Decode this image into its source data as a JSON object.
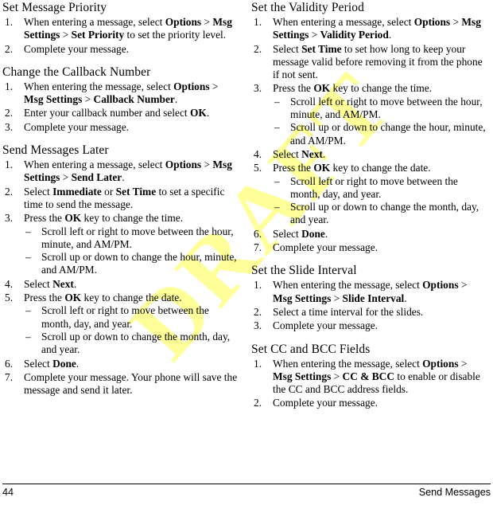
{
  "page": {
    "number": "44",
    "running_head": "Send Messages",
    "watermark": "DRAFT",
    "watermark_color": "#ffff99"
  },
  "left_column": {
    "sections": [
      {
        "heading": "Set Message Priority",
        "steps": [
          {
            "parts": [
              {
                "t": "When entering a message, select ",
                "b": false
              },
              {
                "t": "Options",
                "b": true
              },
              {
                "t": " > ",
                "b": false
              },
              {
                "t": "Msg Settings",
                "b": true
              },
              {
                "t": " > ",
                "b": false
              },
              {
                "t": "Set Priority",
                "b": true
              },
              {
                "t": " to set the priority level.",
                "b": false
              }
            ],
            "subs": []
          },
          {
            "parts": [
              {
                "t": "Complete your message.",
                "b": false
              }
            ],
            "subs": []
          }
        ]
      },
      {
        "heading": "Change the Callback Number",
        "steps": [
          {
            "parts": [
              {
                "t": "When entering the message, select ",
                "b": false
              },
              {
                "t": "Options",
                "b": true
              },
              {
                "t": " > ",
                "b": false
              },
              {
                "t": "Msg Settings",
                "b": true
              },
              {
                "t": " > ",
                "b": false
              },
              {
                "t": "Callback Number",
                "b": true
              },
              {
                "t": ".",
                "b": false
              }
            ],
            "subs": []
          },
          {
            "parts": [
              {
                "t": "Enter your callback number and select ",
                "b": false
              },
              {
                "t": "OK",
                "b": true
              },
              {
                "t": ".",
                "b": false
              }
            ],
            "subs": []
          },
          {
            "parts": [
              {
                "t": "Complete your message.",
                "b": false
              }
            ],
            "subs": []
          }
        ]
      },
      {
        "heading": "Send Messages Later",
        "steps": [
          {
            "parts": [
              {
                "t": "When entering a message, select ",
                "b": false
              },
              {
                "t": "Options",
                "b": true
              },
              {
                "t": " > ",
                "b": false
              },
              {
                "t": "Msg Settings",
                "b": true
              },
              {
                "t": " > ",
                "b": false
              },
              {
                "t": "Send Later",
                "b": true
              },
              {
                "t": ".",
                "b": false
              }
            ],
            "subs": []
          },
          {
            "parts": [
              {
                "t": "Select ",
                "b": false
              },
              {
                "t": "Immediate",
                "b": true
              },
              {
                "t": " or ",
                "b": false
              },
              {
                "t": "Set Time",
                "b": true
              },
              {
                "t": " to set a specific time to send the message.",
                "b": false
              }
            ],
            "subs": []
          },
          {
            "parts": [
              {
                "t": "Press the ",
                "b": false
              },
              {
                "t": "OK",
                "b": true
              },
              {
                "t": " key to change the time.",
                "b": false
              }
            ],
            "subs": [
              "Scroll left or right to move between the hour, minute, and AM/PM.",
              "Scroll up or down to change the hour, minute, and AM/PM."
            ]
          },
          {
            "parts": [
              {
                "t": "Select ",
                "b": false
              },
              {
                "t": "Next",
                "b": true
              },
              {
                "t": ".",
                "b": false
              }
            ],
            "subs": []
          },
          {
            "parts": [
              {
                "t": "Press the ",
                "b": false
              },
              {
                "t": "OK",
                "b": true
              },
              {
                "t": " key to change the date.",
                "b": false
              }
            ],
            "subs": [
              "Scroll left or right to move between the month, day, and year.",
              "Scroll up or down to change the month, day, and year."
            ]
          },
          {
            "parts": [
              {
                "t": "Select ",
                "b": false
              },
              {
                "t": "Done",
                "b": true
              },
              {
                "t": ".",
                "b": false
              }
            ],
            "subs": []
          },
          {
            "parts": [
              {
                "t": "Complete your message. Your phone will save the message and send it later.",
                "b": false
              }
            ],
            "subs": []
          }
        ]
      }
    ]
  },
  "right_column": {
    "sections": [
      {
        "heading": "Set the Validity Period",
        "steps": [
          {
            "parts": [
              {
                "t": "When entering a message, select ",
                "b": false
              },
              {
                "t": "Options",
                "b": true
              },
              {
                "t": " > ",
                "b": false
              },
              {
                "t": "Msg Settings",
                "b": true
              },
              {
                "t": " > ",
                "b": false
              },
              {
                "t": "Validity Period",
                "b": true
              },
              {
                "t": ".",
                "b": false
              }
            ],
            "subs": []
          },
          {
            "parts": [
              {
                "t": "Select ",
                "b": false
              },
              {
                "t": "Set Time",
                "b": true
              },
              {
                "t": " to set how long to keep your message valid before removing it from the phone if not sent.",
                "b": false
              }
            ],
            "subs": []
          },
          {
            "parts": [
              {
                "t": "Press the ",
                "b": false
              },
              {
                "t": "OK",
                "b": true
              },
              {
                "t": " key to change the time.",
                "b": false
              }
            ],
            "subs": [
              "Scroll left or right to move between the hour, minute, and AM/PM.",
              "Scroll up or down to change the hour, minute, and AM/PM."
            ]
          },
          {
            "parts": [
              {
                "t": "Select ",
                "b": false
              },
              {
                "t": "Next",
                "b": true
              },
              {
                "t": ".",
                "b": false
              }
            ],
            "subs": []
          },
          {
            "parts": [
              {
                "t": "Press the ",
                "b": false
              },
              {
                "t": "OK",
                "b": true
              },
              {
                "t": " key to change the date.",
                "b": false
              }
            ],
            "subs": [
              "Scroll left or right to move between the month, day, and year.",
              "Scroll up or down to change the month, day, and year."
            ]
          },
          {
            "parts": [
              {
                "t": "Select ",
                "b": false
              },
              {
                "t": "Done",
                "b": true
              },
              {
                "t": ".",
                "b": false
              }
            ],
            "subs": []
          },
          {
            "parts": [
              {
                "t": "Complete your message.",
                "b": false
              }
            ],
            "subs": []
          }
        ]
      },
      {
        "heading": "Set the Slide Interval",
        "steps": [
          {
            "parts": [
              {
                "t": "When entering the message, select ",
                "b": false
              },
              {
                "t": "Options",
                "b": true
              },
              {
                "t": " > ",
                "b": false
              },
              {
                "t": "Msg Settings",
                "b": true
              },
              {
                "t": " > ",
                "b": false
              },
              {
                "t": "Slide Interval",
                "b": true
              },
              {
                "t": ".",
                "b": false
              }
            ],
            "subs": []
          },
          {
            "parts": [
              {
                "t": "Select a time interval for the slides.",
                "b": false
              }
            ],
            "subs": []
          },
          {
            "parts": [
              {
                "t": "Complete your message.",
                "b": false
              }
            ],
            "subs": []
          }
        ]
      },
      {
        "heading": "Set CC and BCC Fields",
        "steps": [
          {
            "parts": [
              {
                "t": "When entering the message, select ",
                "b": false
              },
              {
                "t": "Options",
                "b": true
              },
              {
                "t": " > ",
                "b": false
              },
              {
                "t": "Msg Settings",
                "b": true
              },
              {
                "t": " > ",
                "b": false
              },
              {
                "t": "CC & BCC",
                "b": true
              },
              {
                "t": " to enable or disable the CC and BCC address fields.",
                "b": false
              }
            ],
            "subs": []
          },
          {
            "parts": [
              {
                "t": "Complete your message.",
                "b": false
              }
            ],
            "subs": []
          }
        ]
      }
    ]
  }
}
